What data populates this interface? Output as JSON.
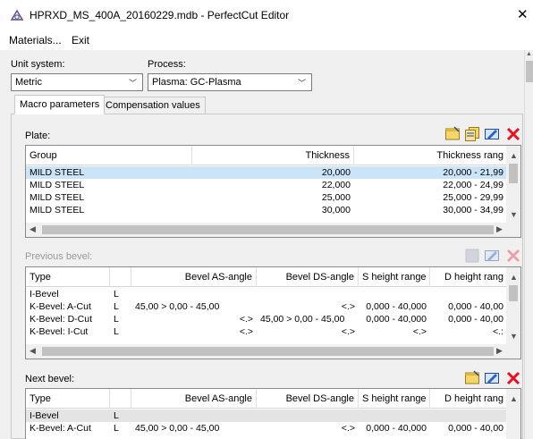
{
  "window": {
    "title": "HPRXD_MS_400A_20160229.mdb - PerfectCut Editor",
    "close": "✕"
  },
  "menu": {
    "materials": "Materials...",
    "exit": "Exit"
  },
  "unit_system": {
    "label": "Unit system:",
    "value": "Metric"
  },
  "process": {
    "label": "Process:",
    "value": "Plasma: GC-Plasma"
  },
  "tabs": [
    {
      "label": "Macro parameters",
      "active": true
    },
    {
      "label": "Compensation values",
      "active": false
    }
  ],
  "plate": {
    "label": "Plate:",
    "columns": [
      "Group",
      "Thickness",
      "Thickness rang"
    ],
    "rows": [
      {
        "group": "MILD STEEL",
        "thickness": "20,000",
        "range": "20,000 - 21,99",
        "selected": true
      },
      {
        "group": "MILD STEEL",
        "thickness": "22,000",
        "range": "22,000 - 24,99"
      },
      {
        "group": "MILD STEEL",
        "thickness": "25,000",
        "range": "25,000 - 29,99"
      },
      {
        "group": "MILD STEEL",
        "thickness": "30,000",
        "range": "30,000 - 34,99"
      }
    ]
  },
  "previous_bevel": {
    "label": "Previous bevel:",
    "columns": [
      "Type",
      "",
      "Bevel AS-angle",
      "Bevel DS-angle",
      "S height range",
      "D height rang"
    ],
    "rows": [
      {
        "type": "I-Bevel",
        "side": "L",
        "as": "",
        "ds": "",
        "s": "",
        "d": ""
      },
      {
        "type": "K-Bevel: A-Cut",
        "side": "L",
        "as": "45,00 > 0,00 - 45,00",
        "ds": "<.>",
        "s": "0,000 - 40,000",
        "d": "0,000 - 40,00"
      },
      {
        "type": "K-Bevel: D-Cut",
        "side": "L",
        "as": "<.>",
        "ds": "45,00 > 0,00 - 45,00",
        "s": "0,000 - 40,000",
        "d": "0,000 - 40,00"
      },
      {
        "type": "K-Bevel: I-Cut",
        "side": "L",
        "as": "<.>",
        "ds": "<.>",
        "s": "<.>",
        "d": "<.:"
      }
    ]
  },
  "next_bevel": {
    "label": "Next bevel:",
    "columns": [
      "Type",
      "",
      "Bevel AS-angle",
      "Bevel DS-angle",
      "S height range",
      "D height rang"
    ],
    "rows": [
      {
        "type": "I-Bevel",
        "side": "L",
        "as": "",
        "ds": "",
        "s": "",
        "d": "",
        "grey": true
      },
      {
        "type": "K-Bevel: A-Cut",
        "side": "L",
        "as": "45,00 > 0,00 - 45,00",
        "ds": "<.>",
        "s": "0,000 - 40,000",
        "d": "0,000 - 40,00"
      }
    ]
  },
  "colors": {
    "selection": "#cce4f7",
    "delete": "#e81123",
    "accent": "#1f4a9c"
  }
}
